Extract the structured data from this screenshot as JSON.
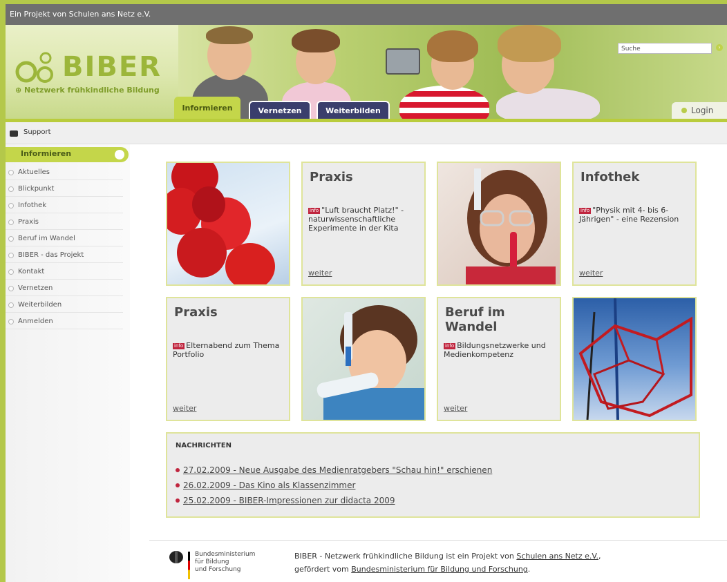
{
  "topbar": {
    "text": "Ein Projekt von Schulen ans Netz e.V."
  },
  "header": {
    "logo_text": "BIBER",
    "logo_subtitle": "Netzwerk frühkindliche Bildung",
    "search_placeholder": "Suche",
    "tabs": [
      {
        "label": "Informieren",
        "active": true
      },
      {
        "label": "Vernetzen",
        "active": false
      },
      {
        "label": "Weiterbilden",
        "active": false
      }
    ],
    "login_label": "Login"
  },
  "support": {
    "label": "Support"
  },
  "sidebar": {
    "active": "Informieren",
    "items": [
      {
        "label": "Aktuelles"
      },
      {
        "label": "Blickpunkt"
      },
      {
        "label": "Infothek"
      },
      {
        "label": "Praxis"
      },
      {
        "label": "Beruf im Wandel"
      },
      {
        "label": "BIBER - das Projekt"
      },
      {
        "label": "Kontakt"
      },
      {
        "label": "Vernetzen"
      },
      {
        "label": "Weiterbilden"
      },
      {
        "label": "Anmelden"
      }
    ]
  },
  "tiles": {
    "t1": {
      "title": "Praxis",
      "tag": "info",
      "body": "\"Luft braucht Platz!\" - naturwissenschaftliche Experimente in der Kita",
      "more": "weiter"
    },
    "t2": {
      "title": "Infothek",
      "tag": "info",
      "body": "\"Physik mit 4- bis 6-Jährigen\" - eine Rezension",
      "more": "weiter"
    },
    "t3": {
      "title": "Praxis",
      "tag": "info",
      "body": "Elternabend zum Thema Portfolio",
      "more": "weiter"
    },
    "t4": {
      "title": "Beruf im Wandel",
      "tag": "info",
      "body": "Bildungsnetzwerke und Medienkompetenz",
      "more": "weiter"
    }
  },
  "news": {
    "title": "NACHRICHTEN",
    "items": [
      {
        "text": "27.02.2009 - Neue Ausgabe des Medienratgebers \"Schau hin!\" erschienen"
      },
      {
        "text": "26.02.2009 - Das Kino als Klassenzimmer"
      },
      {
        "text": "25.02.2009 - BIBER-Impressionen zur didacta 2009"
      }
    ]
  },
  "footer": {
    "bmbf_line1": "Bundesministerium",
    "bmbf_line2": "für Bildung",
    "bmbf_line3": "und Forschung",
    "text_a": "BIBER - Netzwerk frühkindliche Bildung ist ein Projekt von ",
    "link_a": "Schulen ans Netz e.V.",
    "text_b": ",",
    "text_c": "gefördert vom ",
    "link_b": "Bundesministerium für Bildung und Forschung",
    "text_d": "."
  },
  "colors": {
    "accent": "#b9cc3c",
    "tab_dark": "#3a3e6c",
    "info_red": "#c0253e"
  }
}
